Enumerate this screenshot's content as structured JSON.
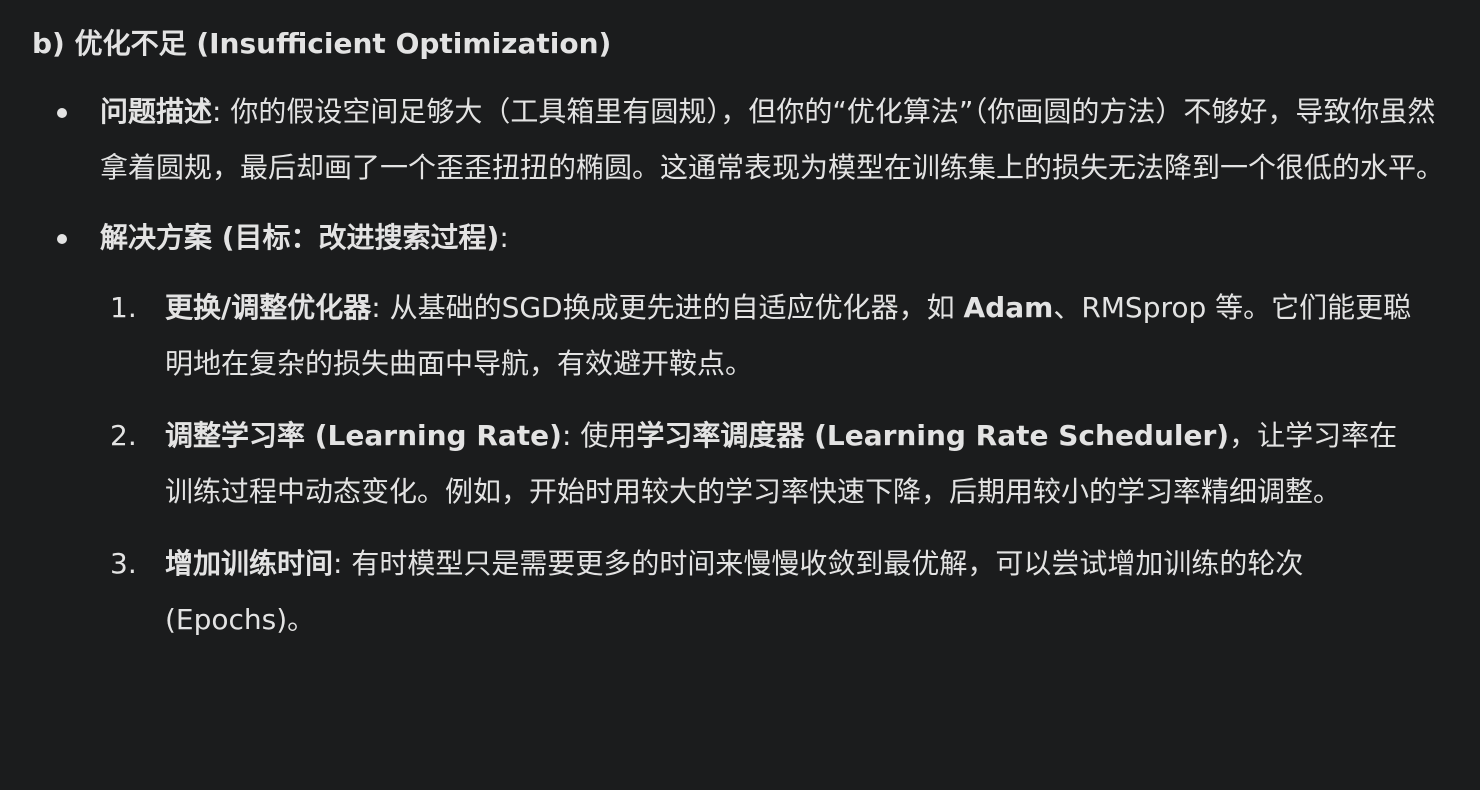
{
  "heading": "b) 优化不足 (Insufficient Optimization)",
  "bullets": [
    {
      "label": "问题描述",
      "sep": ": ",
      "text": "你的假设空间足够大（工具箱里有圆规），但你的“优化算法”（你画圆的方法）不够好，导致你虽然拿着圆规，最后却画了一个歪歪扭扭的椭圆。这通常表现为模型在训练集上的损失无法降到一个很低的水平。"
    },
    {
      "label": "解决方案 (目标：改进搜索过程)",
      "sep": ":"
    }
  ],
  "steps": [
    {
      "number": "1.",
      "label": "更换/调整优化器",
      "sep": ": ",
      "text_1": "从基础的SGD换成更先进的自适应优化器，如 ",
      "bold_1": "Adam",
      "text_2": "、RMSprop 等。它们能更聪明地在复杂的损失曲面中导航，有效避开鞍点。"
    },
    {
      "number": "2.",
      "label": "调整学习率 (Learning Rate)",
      "sep": ": ",
      "text_1": "使用",
      "bold_1": "学习率调度器 (Learning Rate Scheduler)",
      "text_2": "，让学习率在训练过程中动态变化。例如，开始时用较大的学习率快速下降，后期用较小的学习率精细调整。"
    },
    {
      "number": "3.",
      "label": "增加训练时间",
      "sep": ": ",
      "text_1": "有时模型只是需要更多的时间来慢慢收敛到最优解，可以尝试增加训练的轮次 (Epochs)。"
    }
  ]
}
